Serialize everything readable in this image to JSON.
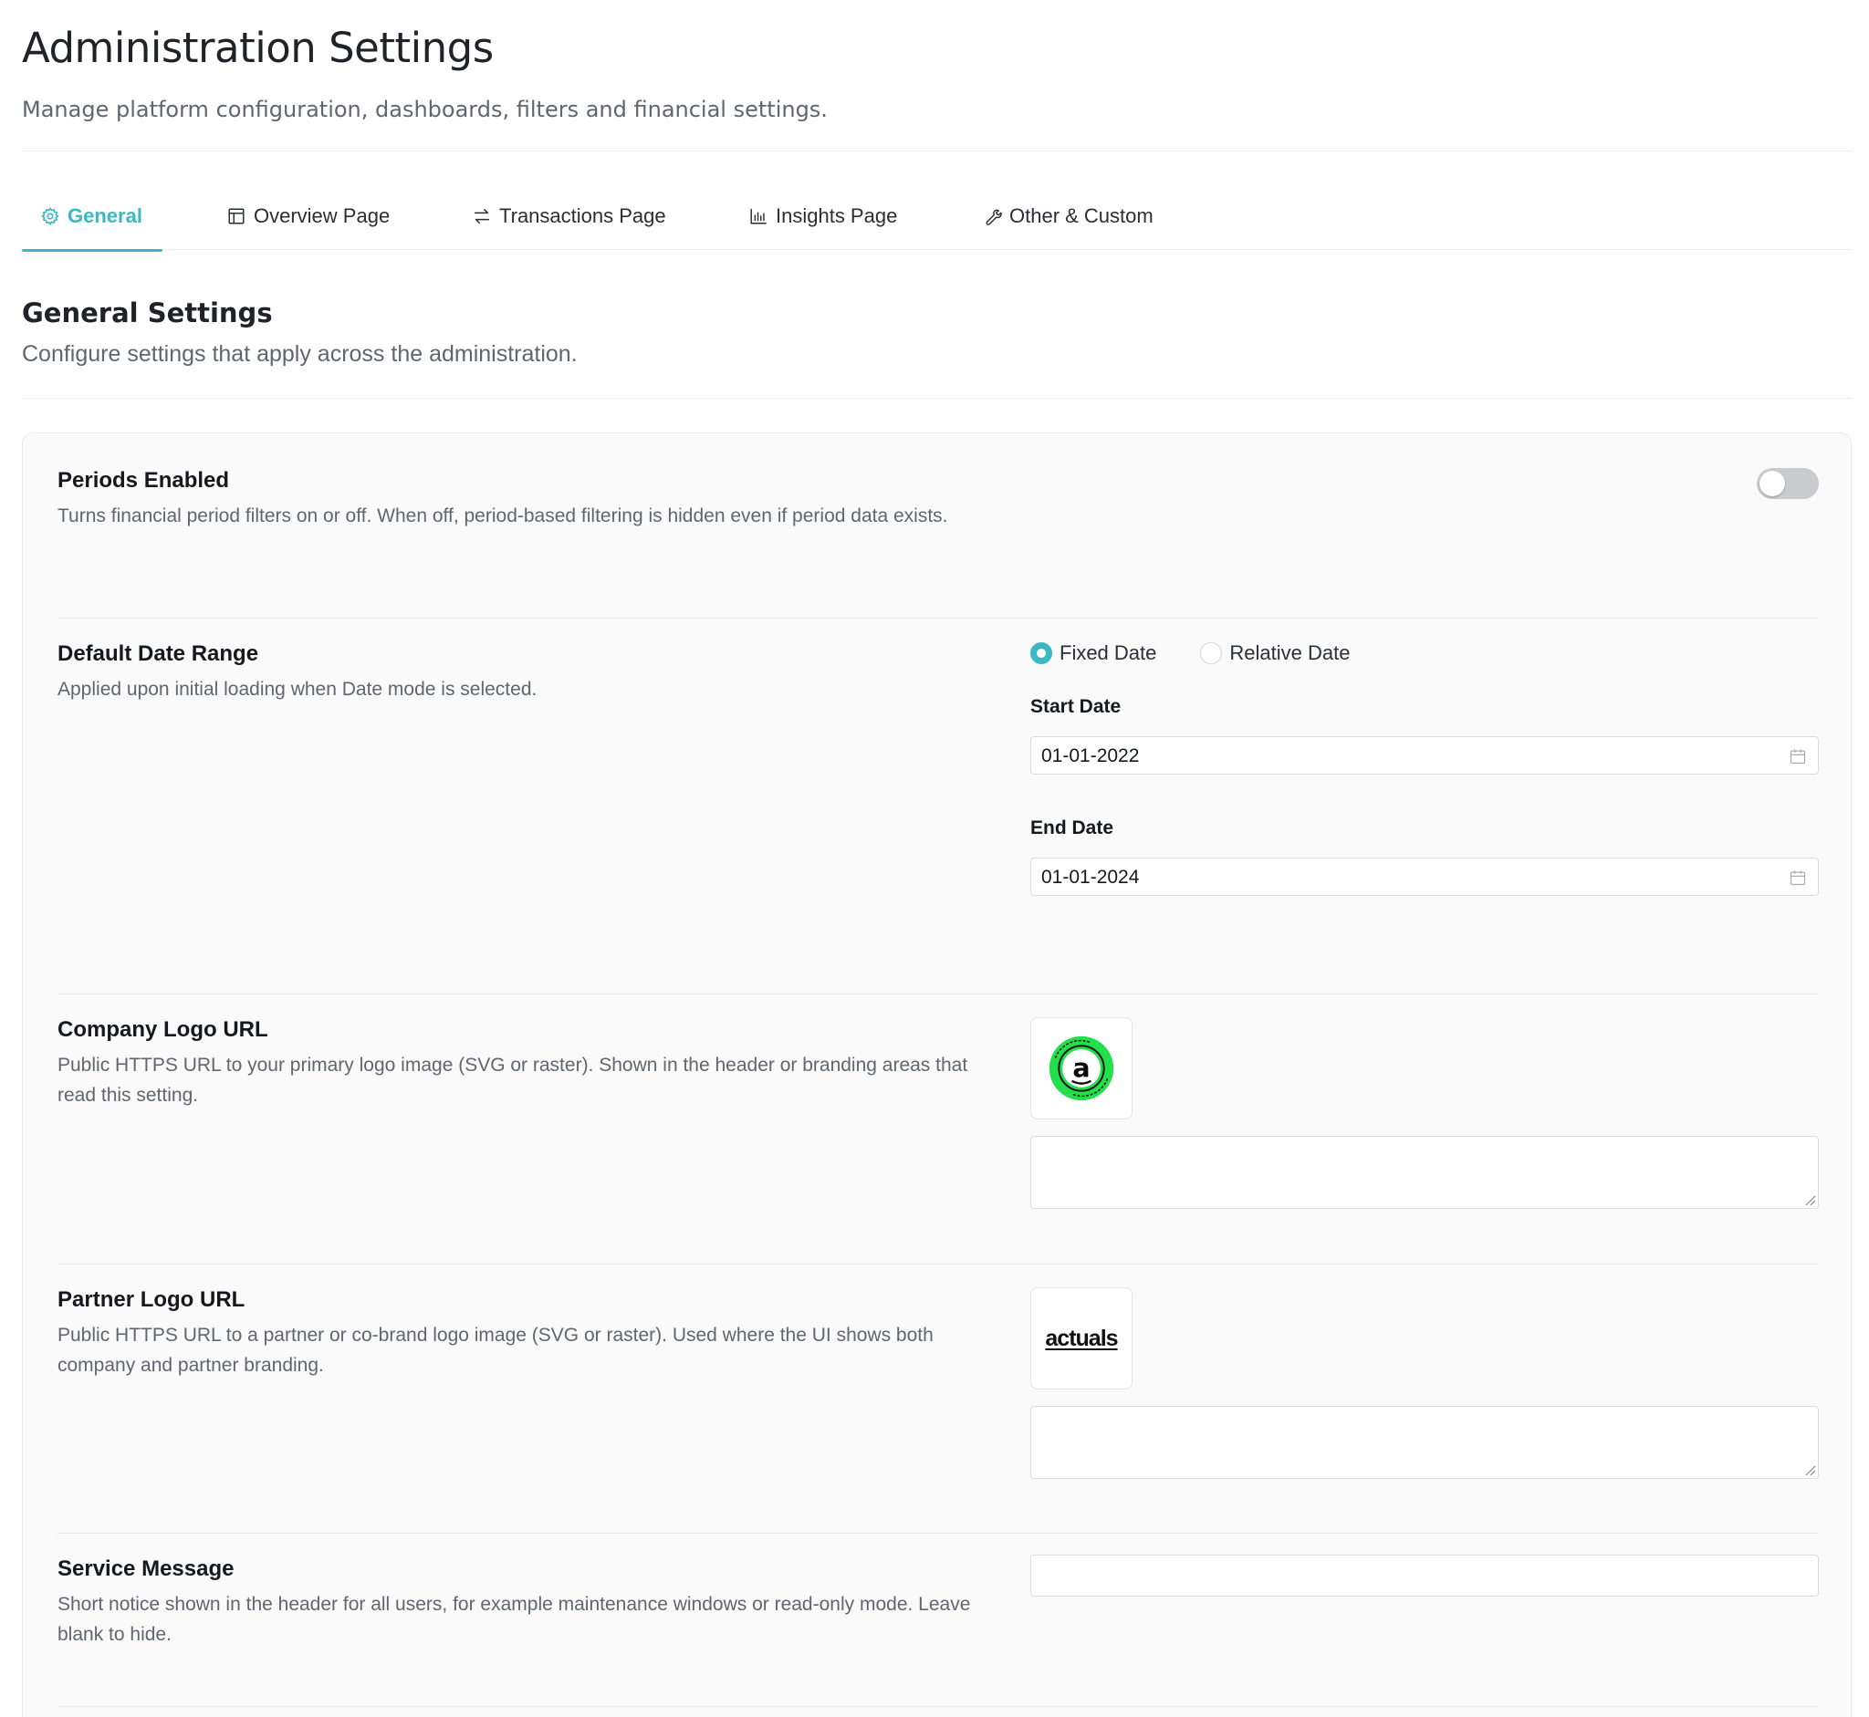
{
  "header": {
    "title": "Administration Settings",
    "subtitle": "Manage platform configuration, dashboards, filters and financial settings."
  },
  "tabs": [
    {
      "label": "General",
      "icon": "gear-icon",
      "active": true
    },
    {
      "label": "Overview Page",
      "icon": "layout-icon",
      "active": false
    },
    {
      "label": "Transactions Page",
      "icon": "arrows-icon",
      "active": false
    },
    {
      "label": "Insights Page",
      "icon": "bar-chart-icon",
      "active": false
    },
    {
      "label": "Other & Custom",
      "icon": "wrench-icon",
      "active": false
    }
  ],
  "section": {
    "title": "General Settings",
    "subtitle": "Configure settings that apply across the administration."
  },
  "settings": {
    "periods": {
      "label": "Periods Enabled",
      "description": "Turns financial period filters on or off. When off, period-based filtering is hidden even if period data exists.",
      "enabled": false
    },
    "date_range": {
      "label": "Default Date Range",
      "description": "Applied upon initial loading when Date mode is selected.",
      "options": [
        "Fixed Date",
        "Relative Date"
      ],
      "selected": "Fixed Date",
      "start_label": "Start Date",
      "start_value": "01-01-2022",
      "end_label": "End Date",
      "end_value": "01-01-2024"
    },
    "company_logo": {
      "label": "Company Logo URL",
      "description": "Public HTTPS URL to your primary logo image (SVG or raster). Shown in the header or branding areas that read this setting.",
      "logo_letter": "a",
      "logo_ring_text": "TRUTH INSIDE",
      "value": ""
    },
    "partner_logo": {
      "label": "Partner Logo URL",
      "description": "Public HTTPS URL to a partner or co-brand logo image (SVG or raster). Used where the UI shows both company and partner branding.",
      "logo_text": "actuals",
      "value": ""
    },
    "service_message": {
      "label": "Service Message",
      "description": "Short notice shown in the header for all users, for example maintenance windows or read-only mode. Leave blank to hide.",
      "value": ""
    }
  },
  "colors": {
    "accent": "#3bb8c4",
    "logo_green": "#22e04a"
  }
}
